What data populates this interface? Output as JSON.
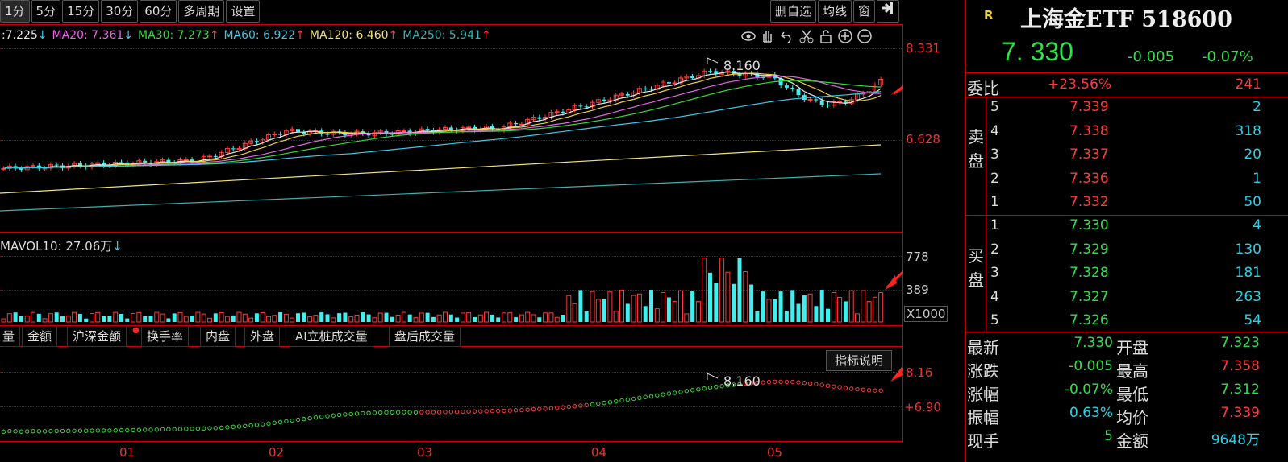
{
  "toolbar": {
    "periods": [
      "1分",
      "5分",
      "15分",
      "30分",
      "60分",
      "多周期",
      "设置"
    ],
    "right_buttons": [
      "删自选",
      "均线",
      "窗"
    ]
  },
  "ma_line": [
    {
      "label": "7.225",
      "arrow": "↓",
      "color": "#e7e7e7"
    },
    {
      "label": "MA20: 7.361",
      "arrow": "↓",
      "color": "#e566e5"
    },
    {
      "label": "MA30: 7.273",
      "arrow": "↑",
      "color": "#36d936"
    },
    {
      "label": "MA60: 6.922",
      "arrow": "↑",
      "color": "#3fc6e6"
    },
    {
      "label": "MA120: 6.460",
      "arrow": "↑",
      "color": "#f0e080"
    },
    {
      "label": "MA250: 5.941",
      "arrow": "↑",
      "color": "#40b0b0"
    }
  ],
  "ma_prefix": ":",
  "price_axis": {
    "high": "8.331",
    "mid": "6.628"
  },
  "peak_label": "8.160",
  "vol": {
    "label": "MAVOL10: 27.06万",
    "arrow": "↓",
    "axis_high": "778",
    "axis_mid": "389",
    "unit": "X1000"
  },
  "tabs": [
    "量",
    "金额",
    "沪深金额",
    "换手率",
    "内盘",
    "外盘",
    "AI立桩成交量",
    "盘后成交量"
  ],
  "indicator": {
    "explain_button": "指标说明",
    "peak": "8.16",
    "low": "+6.90",
    "peak_label": "8.160"
  },
  "months": [
    "01",
    "02",
    "03",
    "04",
    "05"
  ],
  "quote": {
    "badge": "R",
    "title": "上海金ETF 518600",
    "price": "7. 330",
    "change": "-0.005",
    "change_pct": "-0.07%",
    "weibi_label": "委比",
    "weibi_value": "+23.56%",
    "weibi_count": "241",
    "sell_label": [
      "卖",
      "盘"
    ],
    "buy_label": [
      "买",
      "盘"
    ],
    "sell": [
      {
        "lv": "5",
        "price": "7.339",
        "vol": "2"
      },
      {
        "lv": "4",
        "price": "7.338",
        "vol": "318"
      },
      {
        "lv": "3",
        "price": "7.337",
        "vol": "20"
      },
      {
        "lv": "2",
        "price": "7.336",
        "vol": "1"
      },
      {
        "lv": "1",
        "price": "7.332",
        "vol": "50"
      }
    ],
    "buy": [
      {
        "lv": "1",
        "price": "7.330",
        "vol": "4"
      },
      {
        "lv": "2",
        "price": "7.329",
        "vol": "130"
      },
      {
        "lv": "3",
        "price": "7.328",
        "vol": "181"
      },
      {
        "lv": "4",
        "price": "7.327",
        "vol": "263"
      },
      {
        "lv": "5",
        "price": "7.326",
        "vol": "54"
      }
    ],
    "stats": [
      {
        "l1": "最新",
        "v1": "7.330",
        "c1": "green",
        "l2": "开盘",
        "v2": "7.323",
        "c2": "green"
      },
      {
        "l1": "涨跌",
        "v1": "-0.005",
        "c1": "green",
        "l2": "最高",
        "v2": "7.358",
        "c2": "red"
      },
      {
        "l1": "涨幅",
        "v1": "-0.07%",
        "c1": "green",
        "l2": "最低",
        "v2": "7.312",
        "c2": "green"
      },
      {
        "l1": "振幅",
        "v1": "0.63%",
        "c1": "cyan",
        "l2": "均价",
        "v2": "7.339",
        "c2": "red"
      },
      {
        "l1": "现手",
        "v1": "5",
        "c1": "green",
        "l2": "金额",
        "v2": "9648万",
        "c2": "cyan"
      }
    ]
  },
  "colors": {
    "up": "#ff3b3b",
    "down": "#3ef0f0",
    "grid": "#7a1010",
    "border": "#c00000"
  }
}
